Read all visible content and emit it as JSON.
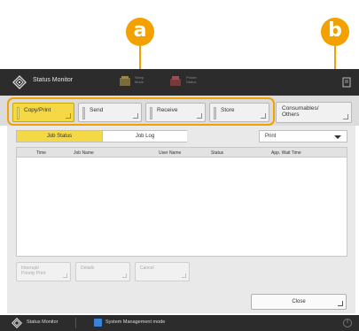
{
  "callouts": {
    "a": "a",
    "b": "b"
  },
  "topbar": {
    "title": "Status Monitor",
    "stat1": "Sleep\nMode",
    "stat2": "Printer\nStatus"
  },
  "tabs": [
    {
      "label": "Copy/Print",
      "active": true
    },
    {
      "label": "Send",
      "active": false
    },
    {
      "label": "Receive",
      "active": false
    },
    {
      "label": "Store",
      "active": false
    }
  ],
  "consumables": {
    "label": "Consumables/\nOthers"
  },
  "subtabs": {
    "job_status": "Job Status",
    "job_log": "Job Log"
  },
  "dropdown": {
    "selected": "Print"
  },
  "table": {
    "columns": [
      "Time",
      "Job Name",
      "User Name",
      "Status",
      "App. Wait Time"
    ]
  },
  "actions": {
    "interrupt": "Interrupt/\nPriority Print",
    "details": "Details",
    "cancel": "Cancel"
  },
  "close": {
    "label": "Close"
  },
  "bottombar": {
    "status_monitor": "Status Monitor",
    "mode": "System Management mode"
  },
  "colors": {
    "accent": "#f2a100",
    "active_tab": "#f4d846",
    "bar": "#2c2c2c"
  }
}
